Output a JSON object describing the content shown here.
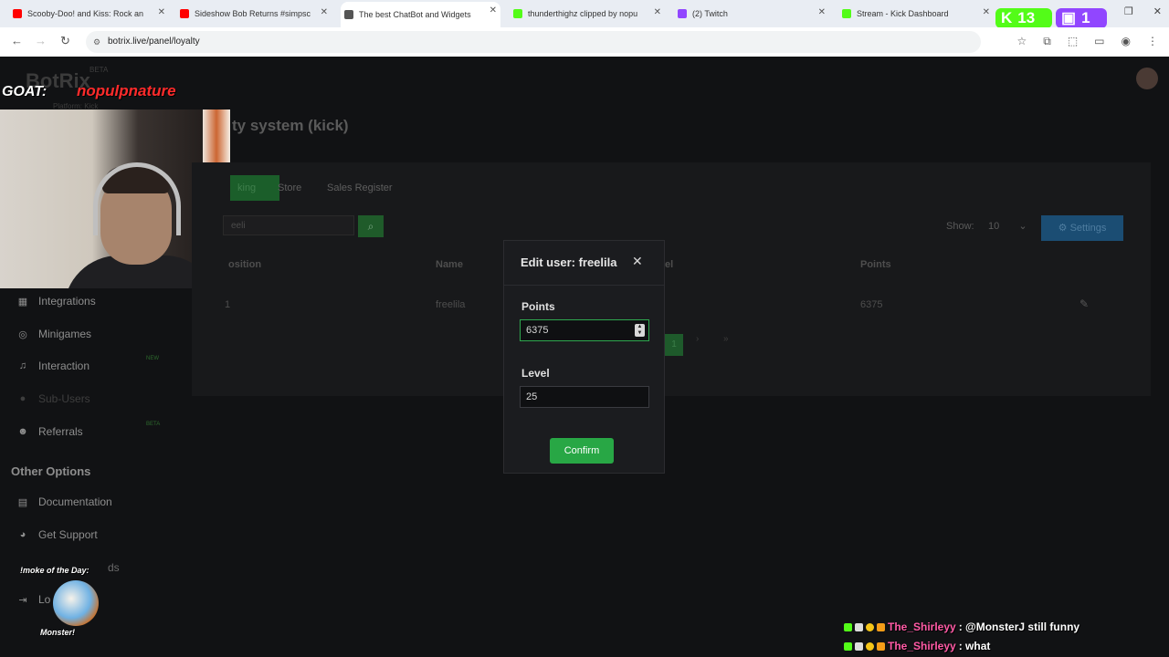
{
  "browser": {
    "tabs": [
      {
        "title": "Scooby-Doo! and Kiss: Rock an",
        "color": "#ff0000"
      },
      {
        "title": "Sideshow Bob Returns #simpsc",
        "color": "#ff0000"
      },
      {
        "title": "The best ChatBot and Widgets",
        "color": "#333333"
      },
      {
        "title": "thunderthighz clipped by nopu",
        "color": "#53fc18"
      },
      {
        "title": "(2) Twitch",
        "color": "#9146ff"
      },
      {
        "title": "Stream - Kick Dashboard",
        "color": "#53fc18"
      }
    ],
    "url": "botrix.live/panel/loyalty",
    "kick_count": "13",
    "twitch_count": "1"
  },
  "overlay": {
    "goat_label": "GOAT:",
    "goat_name": "nopulpnature",
    "smoke_label": "!moke of the Day:",
    "smoke_name": "Monster!",
    "chat": [
      {
        "user": "The_Shirleyy",
        "message": ": @MonsterJ still funny"
      },
      {
        "user": "The_Shirleyy",
        "message": ": what"
      }
    ]
  },
  "app": {
    "logo": "BotRix",
    "beta": "BETA",
    "platform": "Platform: Kick",
    "page_title": "ty system (kick)",
    "sidebar": {
      "items": [
        {
          "label": "Integrations"
        },
        {
          "label": "Minigames"
        },
        {
          "label": "Interaction",
          "badge": "NEW"
        },
        {
          "label": "Sub-Users"
        },
        {
          "label": "Referrals",
          "badge": "BETA"
        }
      ],
      "other_title": "Other Options",
      "other_items": [
        {
          "label": "Documentation"
        },
        {
          "label": "Get Support"
        },
        {
          "label": "ds"
        },
        {
          "label": "Lo"
        }
      ]
    },
    "tabs": {
      "ranking": "king",
      "store": "Store",
      "sales": "Sales Register"
    },
    "search_value": "eeli",
    "show_label": "Show:",
    "show_value": "10",
    "settings_label": "Settings",
    "table": {
      "headers": {
        "position": "osition",
        "name": "Name",
        "level": "el",
        "points": "Points"
      },
      "row": {
        "position": "1",
        "name": "freelila",
        "points": "6375"
      }
    },
    "pagination": {
      "current": "1"
    }
  },
  "modal": {
    "title": "Edit user: freelila",
    "points_label": "Points",
    "points_value": "6375",
    "level_label": "Level",
    "level_value": "25",
    "confirm_label": "Confirm"
  }
}
